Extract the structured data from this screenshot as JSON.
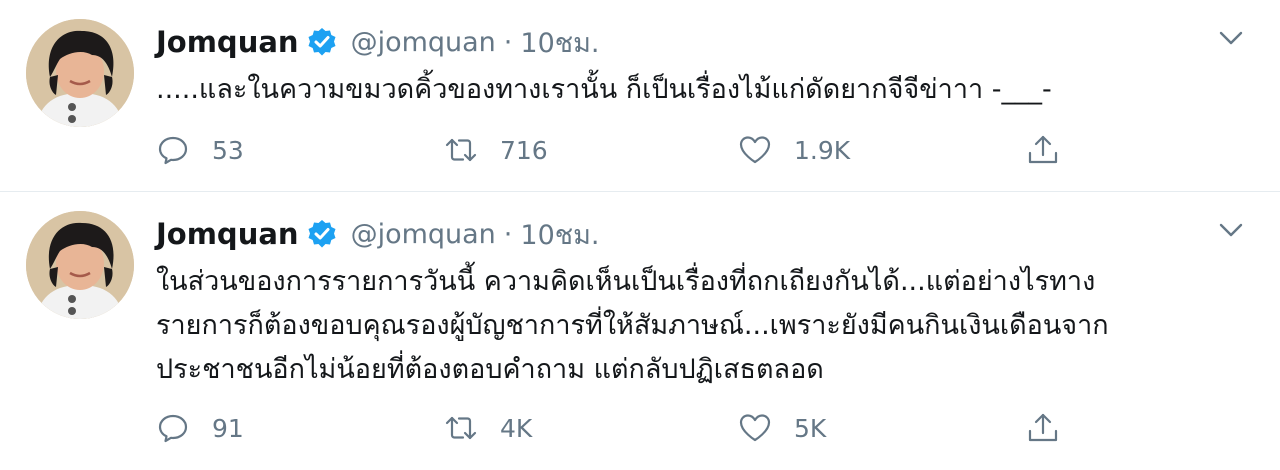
{
  "colors": {
    "verified_blue": "#1da1f2",
    "text": "#14171a",
    "muted": "#657786",
    "divider": "#e6ecf0"
  },
  "icons": {
    "reply": "speech-bubble-icon",
    "retweet": "retweet-arrows-icon",
    "like": "heart-icon",
    "share": "share-upload-icon",
    "verified": "verified-badge-icon",
    "menu": "chevron-down-icon"
  },
  "tweets": [
    {
      "author": {
        "name": "Jomquan",
        "handle": "@jomquan"
      },
      "separator": "·",
      "time": "10ชม.",
      "text": ".....และในความขมวดคิ้วของทางเรานั้น ก็เป็นเรื่องไม้แก่ดัดยากจีจีข่าาา -___-",
      "stats": {
        "replies": "53",
        "retweets": "716",
        "likes": "1.9K"
      }
    },
    {
      "author": {
        "name": "Jomquan",
        "handle": "@jomquan"
      },
      "separator": "·",
      "time": "10ชม.",
      "text": "ในส่วนของการรายการวันนี้ ความคิดเห็นเป็นเรื่องที่ถกเถียงกันได้...แต่อย่างไรทาง\nรายการก็ต้องขอบคุณรองผู้บัญชาการที่ให้สัมภาษณ์...เพราะยังมีคนกินเงินเดือนจาก\nประชาชนอีกไม่น้อยที่ต้องตอบคำถาม แต่กลับปฏิเสธตลอด",
      "stats": {
        "replies": "91",
        "retweets": "4K",
        "likes": "5K"
      }
    }
  ]
}
